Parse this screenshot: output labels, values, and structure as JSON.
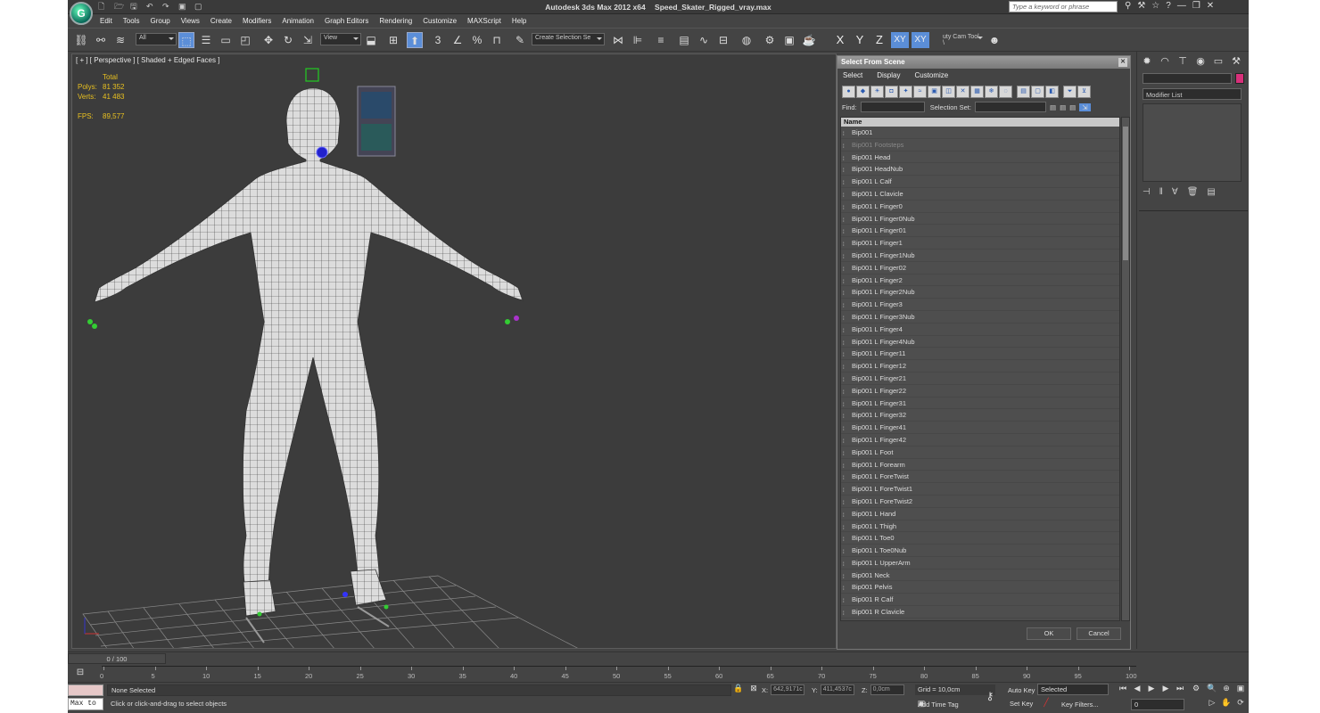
{
  "app": {
    "title": "Autodesk 3ds Max  2012 x64",
    "file": "Speed_Skater_Rigged_vray.max",
    "logo": "G",
    "search_placeholder": "Type a keyword or phrase"
  },
  "menu": [
    "Edit",
    "Tools",
    "Group",
    "Views",
    "Create",
    "Modifiers",
    "Animation",
    "Graph Editors",
    "Rendering",
    "Customize",
    "MAXScript",
    "Help"
  ],
  "toolbar": {
    "filter": "All",
    "ref_coord": "View",
    "selection_set": "Create Selection Se",
    "axes": [
      "X",
      "Y",
      "Z",
      "XY",
      "XY"
    ],
    "utility": "uty Cam Tool \\",
    "snap_label": "3",
    "angle_snap_label": "%"
  },
  "viewport": {
    "label": "[ + ] [ Perspective ] [ Shaded + Edged Faces ]",
    "total_label": "Total",
    "polys_label": "Polys:",
    "polys": "81 352",
    "verts_label": "Verts:",
    "verts": "41 483",
    "fps_label": "FPS:",
    "fps": "89,577"
  },
  "dialog": {
    "title": "Select From Scene",
    "menu": [
      "Select",
      "Display",
      "Customize"
    ],
    "find_label": "Find:",
    "selection_set_label": "Selection Set:",
    "column_header": "Name",
    "items": [
      {
        "name": "Bip001",
        "dim": false
      },
      {
        "name": "Bip001 Footsteps",
        "dim": true
      },
      {
        "name": "Bip001 Head",
        "dim": false
      },
      {
        "name": "Bip001 HeadNub",
        "dim": false
      },
      {
        "name": "Bip001 L Calf",
        "dim": false
      },
      {
        "name": "Bip001 L Clavicle",
        "dim": false
      },
      {
        "name": "Bip001 L Finger0",
        "dim": false
      },
      {
        "name": "Bip001 L Finger0Nub",
        "dim": false
      },
      {
        "name": "Bip001 L Finger01",
        "dim": false
      },
      {
        "name": "Bip001 L Finger1",
        "dim": false
      },
      {
        "name": "Bip001 L Finger1Nub",
        "dim": false
      },
      {
        "name": "Bip001 L Finger02",
        "dim": false
      },
      {
        "name": "Bip001 L Finger2",
        "dim": false
      },
      {
        "name": "Bip001 L Finger2Nub",
        "dim": false
      },
      {
        "name": "Bip001 L Finger3",
        "dim": false
      },
      {
        "name": "Bip001 L Finger3Nub",
        "dim": false
      },
      {
        "name": "Bip001 L Finger4",
        "dim": false
      },
      {
        "name": "Bip001 L Finger4Nub",
        "dim": false
      },
      {
        "name": "Bip001 L Finger11",
        "dim": false
      },
      {
        "name": "Bip001 L Finger12",
        "dim": false
      },
      {
        "name": "Bip001 L Finger21",
        "dim": false
      },
      {
        "name": "Bip001 L Finger22",
        "dim": false
      },
      {
        "name": "Bip001 L Finger31",
        "dim": false
      },
      {
        "name": "Bip001 L Finger32",
        "dim": false
      },
      {
        "name": "Bip001 L Finger41",
        "dim": false
      },
      {
        "name": "Bip001 L Finger42",
        "dim": false
      },
      {
        "name": "Bip001 L Foot",
        "dim": false
      },
      {
        "name": "Bip001 L Forearm",
        "dim": false
      },
      {
        "name": "Bip001 L ForeTwist",
        "dim": false
      },
      {
        "name": "Bip001 L ForeTwist1",
        "dim": false
      },
      {
        "name": "Bip001 L ForeTwist2",
        "dim": false
      },
      {
        "name": "Bip001 L Hand",
        "dim": false
      },
      {
        "name": "Bip001 L Thigh",
        "dim": false
      },
      {
        "name": "Bip001 L Toe0",
        "dim": false
      },
      {
        "name": "Bip001 L Toe0Nub",
        "dim": false
      },
      {
        "name": "Bip001 L UpperArm",
        "dim": false
      },
      {
        "name": "Bip001 Neck",
        "dim": false
      },
      {
        "name": "Bip001 Pelvis",
        "dim": false
      },
      {
        "name": "Bip001 R Calf",
        "dim": false
      },
      {
        "name": "Bip001 R Clavicle",
        "dim": false
      }
    ],
    "ok": "OK",
    "cancel": "Cancel"
  },
  "command_panel": {
    "modifier_list": "Modifier List",
    "object_color": "#d8307a"
  },
  "timeline": {
    "slider": "0 / 100",
    "ticks": [
      "0",
      "5",
      "10",
      "15",
      "20",
      "25",
      "30",
      "35",
      "40",
      "45",
      "50",
      "55",
      "60",
      "65",
      "70",
      "75",
      "80",
      "85",
      "90",
      "95",
      "100"
    ]
  },
  "status": {
    "maxscript": "Max to",
    "selection": "None Selected",
    "prompt": "Click or click-and-drag to select objects",
    "x_label": "X:",
    "x": "642,9171c",
    "y_label": "Y:",
    "y": "411,4537c",
    "z_label": "Z:",
    "z": "0,0cm",
    "grid": "Grid = 10,0cm",
    "auto_key": "Auto Key",
    "set_key": "Set Key",
    "key_mode": "Selected",
    "key_filters": "Key Filters...",
    "add_time_tag": "Add Time Tag",
    "frame": "0"
  },
  "colors": {
    "accent": "#5b8ed8",
    "stats": "#e8c020",
    "bg": "#444444"
  }
}
